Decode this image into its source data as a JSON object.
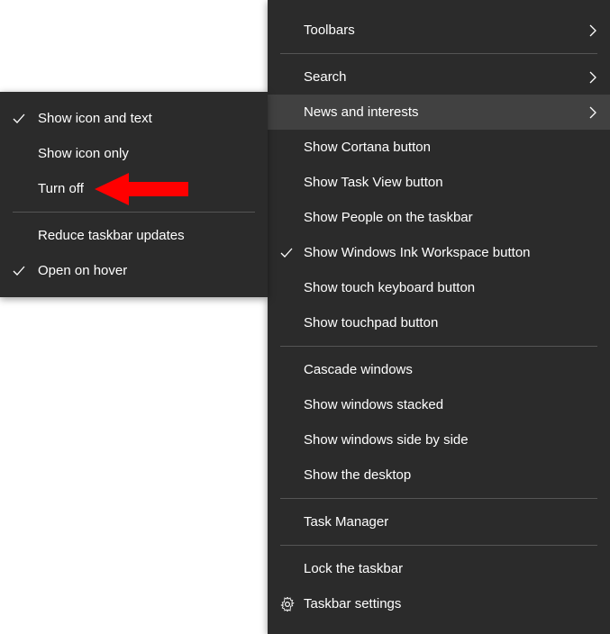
{
  "main_menu": {
    "items": [
      {
        "label": "Toolbars",
        "has_submenu": true
      },
      {
        "separator": true
      },
      {
        "label": "Search",
        "has_submenu": true
      },
      {
        "label": "News and interests",
        "has_submenu": true,
        "highlighted": true
      },
      {
        "label": "Show Cortana button"
      },
      {
        "label": "Show Task View button"
      },
      {
        "label": "Show People on the taskbar"
      },
      {
        "label": "Show Windows Ink Workspace button",
        "checked": true
      },
      {
        "label": "Show touch keyboard button"
      },
      {
        "label": "Show touchpad button"
      },
      {
        "separator": true
      },
      {
        "label": "Cascade windows"
      },
      {
        "label": "Show windows stacked"
      },
      {
        "label": "Show windows side by side"
      },
      {
        "label": "Show the desktop"
      },
      {
        "separator": true
      },
      {
        "label": "Task Manager"
      },
      {
        "separator": true
      },
      {
        "label": "Lock the taskbar"
      },
      {
        "label": "Taskbar settings",
        "icon": "gear"
      }
    ]
  },
  "sub_menu": {
    "items": [
      {
        "label": "Show icon and text",
        "checked": true
      },
      {
        "label": "Show icon only"
      },
      {
        "label": "Turn off",
        "arrow_target": true
      },
      {
        "separator": true
      },
      {
        "label": "Reduce taskbar updates"
      },
      {
        "label": "Open on hover",
        "checked": true
      }
    ]
  },
  "annotation": {
    "color": "#ff0000"
  }
}
